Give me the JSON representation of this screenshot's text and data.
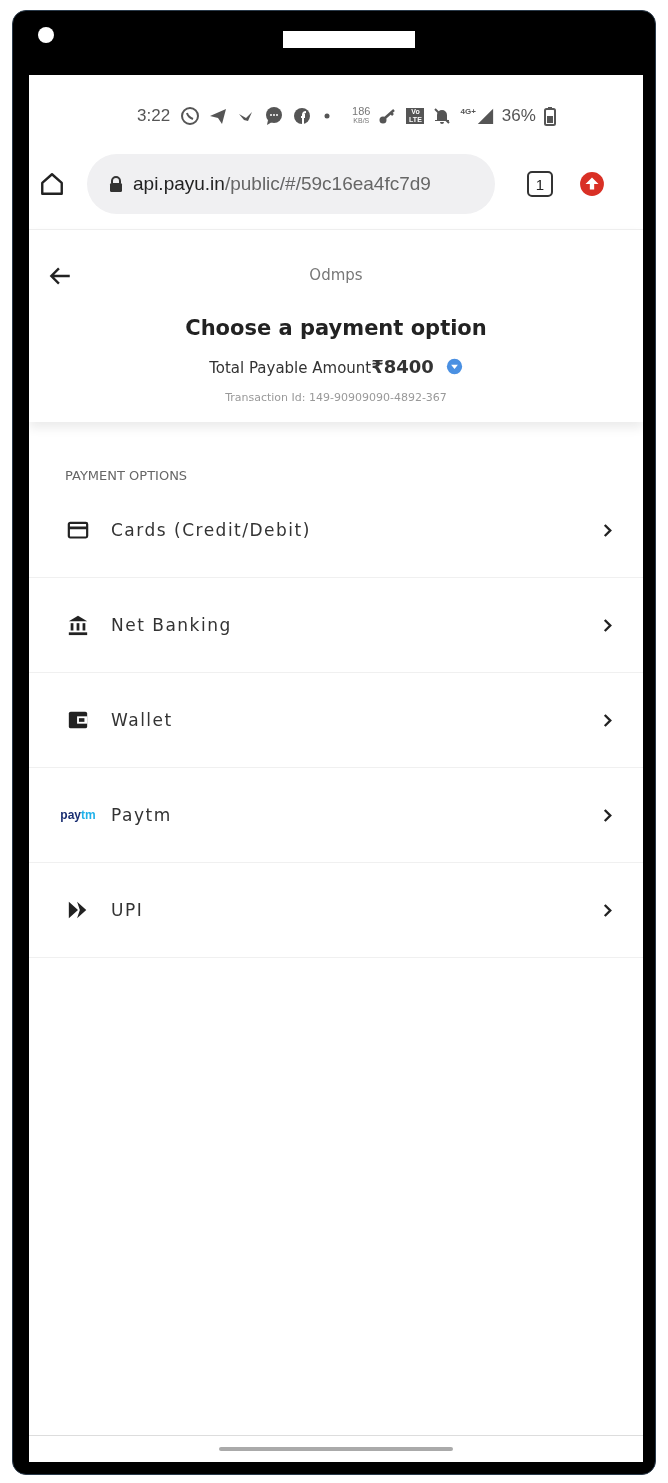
{
  "status_bar": {
    "time": "3:22",
    "speed": "186",
    "speed_unit": "KB/S",
    "network": "4G+",
    "volte": "Vo LTE",
    "battery": "36%"
  },
  "browser": {
    "url_host": "api.payu.in",
    "url_path": "/public/#/59c16ea4fc7d9",
    "tab_count": "1"
  },
  "header": {
    "merchant": "Odmps",
    "title": "Choose a payment option",
    "amount_label": "Total Payable Amount",
    "amount": "₹8400",
    "transaction": "Transaction Id: 149-90909090-4892-367"
  },
  "section_label": "PAYMENT OPTIONS",
  "options": [
    {
      "kind": "card",
      "label": "Cards (Credit/Debit)"
    },
    {
      "kind": "bank",
      "label": "Net Banking"
    },
    {
      "kind": "wallet",
      "label": "Wallet"
    },
    {
      "kind": "paytm",
      "label": "Paytm",
      "logo_pre": "pay",
      "logo_post": "tm"
    },
    {
      "kind": "upi",
      "label": "UPI"
    }
  ]
}
